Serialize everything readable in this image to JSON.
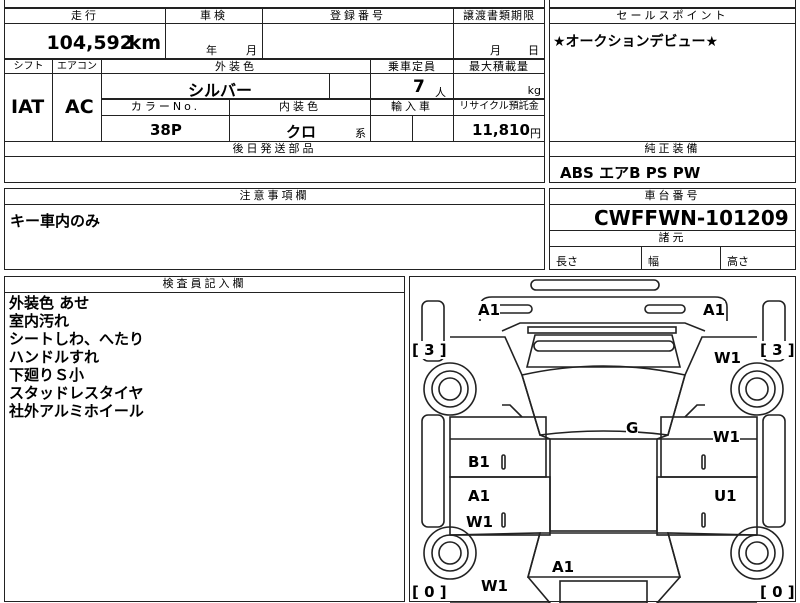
{
  "top": {
    "mileage_header": "走行",
    "mileage_value": "104,592",
    "mileage_unit": "km",
    "inspection_header": "車検",
    "inspection_year": "年",
    "inspection_month": "月",
    "reg_header": "登録番号",
    "transfer_header": "譲渡書類期限",
    "transfer_month": "月",
    "transfer_day": "日",
    "salespoint_header": "セールスポイント",
    "salespoint_text": "★オークションデビュー★"
  },
  "spec": {
    "shift_header": "シフト",
    "shift_value": "IAT",
    "ac_header": "エアコン",
    "ac_value": "AC",
    "ext_color_header": "外装色",
    "ext_color_value": "シルバー",
    "capacity_header": "乗車定員",
    "capacity_value": "7",
    "capacity_unit": "人",
    "maxload_header": "最大積載量",
    "maxload_unit": "kg",
    "colorno_header": "カラーNo.",
    "colorno_value": "38P",
    "interior_header": "内装色",
    "interior_value": "クロ",
    "interior_suffix": "系",
    "import_header": "輸入車",
    "recycle_header": "リサイクル預託金",
    "recycle_value": "11,810",
    "recycle_unit": "円",
    "later_parts_header": "後日発送部品"
  },
  "equipment": {
    "header": "純正装備",
    "value": "ABS エアB PS PW"
  },
  "notes": {
    "header": "注意事項欄",
    "value": "キー車内のみ"
  },
  "chassis": {
    "header": "車台番号",
    "value": "CWFFWN-101209",
    "dims_header": "諸元",
    "length_label": "長さ",
    "width_label": "幅",
    "height_label": "高さ"
  },
  "inspector": {
    "header": "検査員記入欄",
    "lines": [
      "外装色 あせ",
      "室内汚れ",
      "シートしわ、へたり",
      "ハンドルすれ",
      "下廻りＳ小",
      "スタッドレスタイヤ",
      "社外アルミホイール"
    ]
  },
  "diagram": {
    "marks": {
      "front_left": "A1",
      "front_right": "A1",
      "right_front_fender": "W1",
      "windshield_area": "G",
      "right_front_door": "W1",
      "left_front_door": "B1",
      "right_rear_door": "U1",
      "left_rear_door_a": "A1",
      "left_rear_door_w": "W1",
      "rear_left": "W1",
      "rear_center": "A1"
    },
    "tread": {
      "front_left": "3",
      "front_right": "3",
      "rear_left": "0",
      "rear_right": "0"
    }
  }
}
